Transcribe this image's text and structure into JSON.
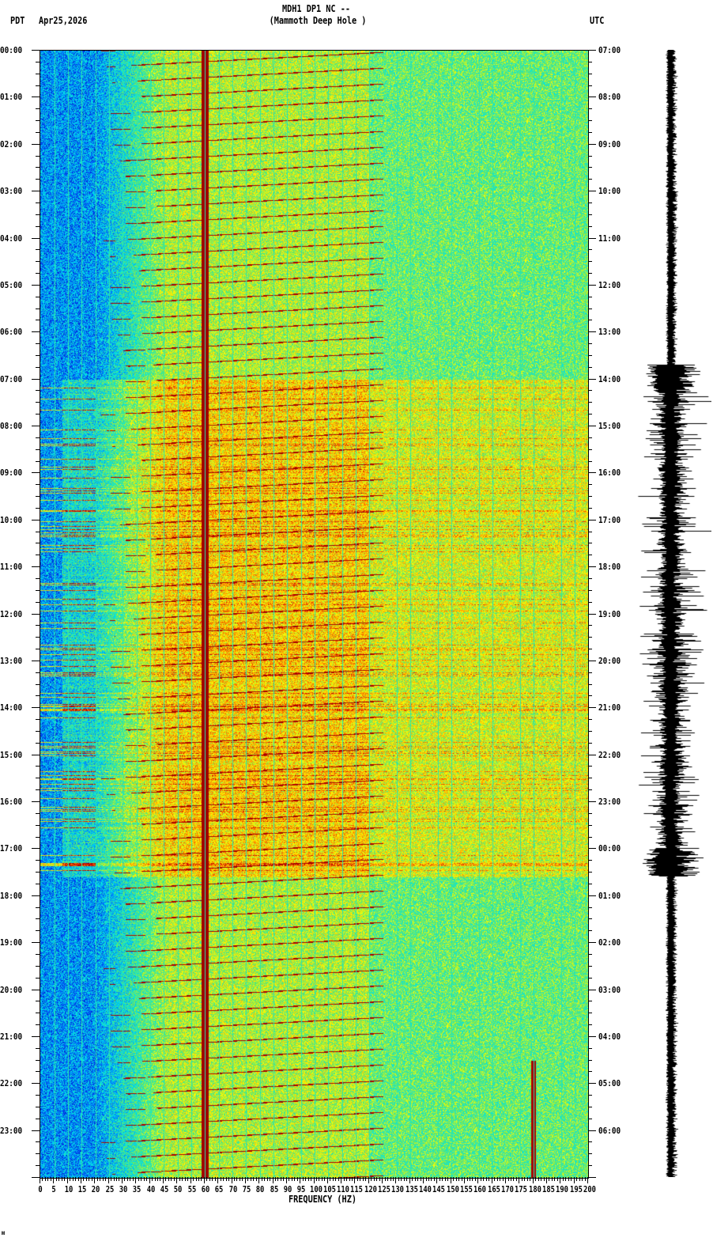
{
  "header": {
    "title": "MDH1 DP1 NC --",
    "subtitle": "(Mammoth Deep Hole )",
    "left_tz": "PDT",
    "date": "Apr25,2026",
    "right_tz": "UTC"
  },
  "footer_mark": "ᴍ",
  "chart_data": {
    "type": "heatmap",
    "title": "MDH1 DP1 NC -- (Mammoth Deep Hole )",
    "xlabel": "FREQUENCY (HZ)",
    "xlim": [
      0,
      200
    ],
    "x_ticks": [
      "0",
      "5",
      "10",
      "15",
      "20",
      "25",
      "30",
      "35",
      "40",
      "45",
      "50",
      "55",
      "60",
      "65",
      "70",
      "75",
      "80",
      "85",
      "90",
      "95",
      "100",
      "105",
      "110",
      "115",
      "120",
      "125",
      "130",
      "135",
      "140",
      "145",
      "150",
      "155",
      "160",
      "165",
      "170",
      "175",
      "180",
      "185",
      "190",
      "195",
      "200"
    ],
    "y_left_label": "PDT",
    "y_left_ticks": [
      "00:00",
      "01:00",
      "02:00",
      "03:00",
      "04:00",
      "05:00",
      "06:00",
      "07:00",
      "08:00",
      "09:00",
      "10:00",
      "11:00",
      "12:00",
      "13:00",
      "14:00",
      "15:00",
      "16:00",
      "17:00",
      "18:00",
      "19:00",
      "20:00",
      "21:00",
      "22:00",
      "23:00"
    ],
    "y_right_label": "UTC",
    "y_right_ticks": [
      "07:00",
      "08:00",
      "09:00",
      "10:00",
      "11:00",
      "12:00",
      "13:00",
      "14:00",
      "15:00",
      "16:00",
      "17:00",
      "18:00",
      "19:00",
      "20:00",
      "21:00",
      "22:00",
      "23:00",
      "00:00",
      "01:00",
      "02:00",
      "03:00",
      "04:00",
      "05:00",
      "06:00"
    ],
    "ylim_hours": [
      0,
      24
    ],
    "persistent_lines_hz": [
      60
    ],
    "late_line_hz": 180,
    "late_line_start_hour": 21.5,
    "active_period_hours_pdt": [
      7.0,
      17.6
    ],
    "colormap": [
      "#0000c8",
      "#0078ff",
      "#00e6e6",
      "#64e664",
      "#ffff00",
      "#ff8c00",
      "#c80000",
      "#960000"
    ]
  }
}
